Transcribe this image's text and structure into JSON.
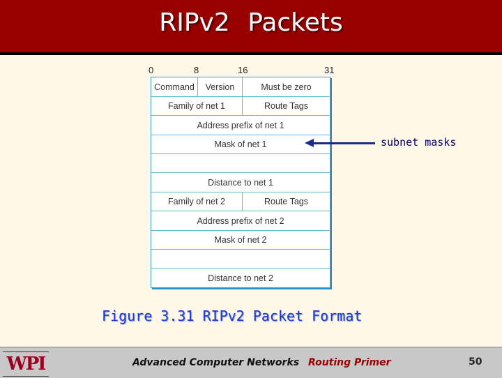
{
  "slide": {
    "title": "RIPv2 Packets",
    "annotation": "subnet masks",
    "caption": "Figure 3.31 RIPv2 Packet Format"
  },
  "diagram": {
    "bit_labels": [
      "0",
      "8",
      "16",
      "31"
    ],
    "rows": [
      {
        "cells": [
          "Command",
          "Version",
          "Must be zero"
        ]
      },
      {
        "cells": [
          "Family of net 1",
          "Route Tags"
        ]
      },
      {
        "cells": [
          "Address prefix of net 1"
        ]
      },
      {
        "cells": [
          "Mask of net 1"
        ]
      },
      {
        "cells": [
          ""
        ]
      },
      {
        "cells": [
          "Distance to net 1"
        ]
      },
      {
        "cells": [
          "Family of net 2",
          "Route Tags"
        ]
      },
      {
        "cells": [
          "Address prefix of net 2"
        ]
      },
      {
        "cells": [
          "Mask of net 2"
        ]
      },
      {
        "cells": [
          ""
        ]
      },
      {
        "cells": [
          "Distance to net 2"
        ]
      }
    ]
  },
  "footer": {
    "logo": "WPI",
    "course": "Advanced Computer Networks",
    "topic": "Routing Primer",
    "page": "50"
  },
  "colors": {
    "header_bg": "#990000",
    "packet_border": "#3aa0cf",
    "arrow": "#1a2a8a",
    "caption": "#1a3ad0"
  }
}
